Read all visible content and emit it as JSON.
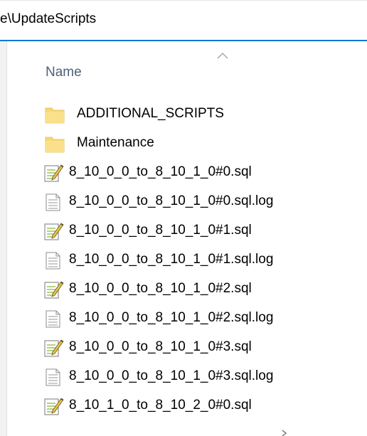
{
  "address_bar": {
    "path": "e\\UpdateScripts"
  },
  "column": {
    "name_label": "Name",
    "sort_icon": "chevron-up-icon"
  },
  "items": [
    {
      "label": "ADDITIONAL_SCRIPTS",
      "type": "folder",
      "icon": "folder-icon"
    },
    {
      "label": "Maintenance",
      "type": "folder",
      "icon": "folder-icon"
    },
    {
      "label": "8_10_0_0_to_8_10_1_0#0.sql",
      "type": "sql",
      "icon": "sql-script-icon"
    },
    {
      "label": "8_10_0_0_to_8_10_1_0#0.sql.log",
      "type": "log",
      "icon": "text-file-icon"
    },
    {
      "label": "8_10_0_0_to_8_10_1_0#1.sql",
      "type": "sql",
      "icon": "sql-script-icon"
    },
    {
      "label": "8_10_0_0_to_8_10_1_0#1.sql.log",
      "type": "log",
      "icon": "text-file-icon"
    },
    {
      "label": "8_10_0_0_to_8_10_1_0#2.sql",
      "type": "sql",
      "icon": "sql-script-icon"
    },
    {
      "label": "8_10_0_0_to_8_10_1_0#2.sql.log",
      "type": "log",
      "icon": "text-file-icon"
    },
    {
      "label": "8_10_0_0_to_8_10_1_0#3.sql",
      "type": "sql",
      "icon": "sql-script-icon"
    },
    {
      "label": "8_10_0_0_to_8_10_1_0#3.sql.log",
      "type": "log",
      "icon": "text-file-icon"
    },
    {
      "label": "8_10_1_0_to_8_10_2_0#0.sql",
      "type": "sql",
      "icon": "sql-script-icon"
    }
  ],
  "colors": {
    "accent": "#0a78d7",
    "header_text": "#4c607a",
    "folder": "#f8d775"
  }
}
